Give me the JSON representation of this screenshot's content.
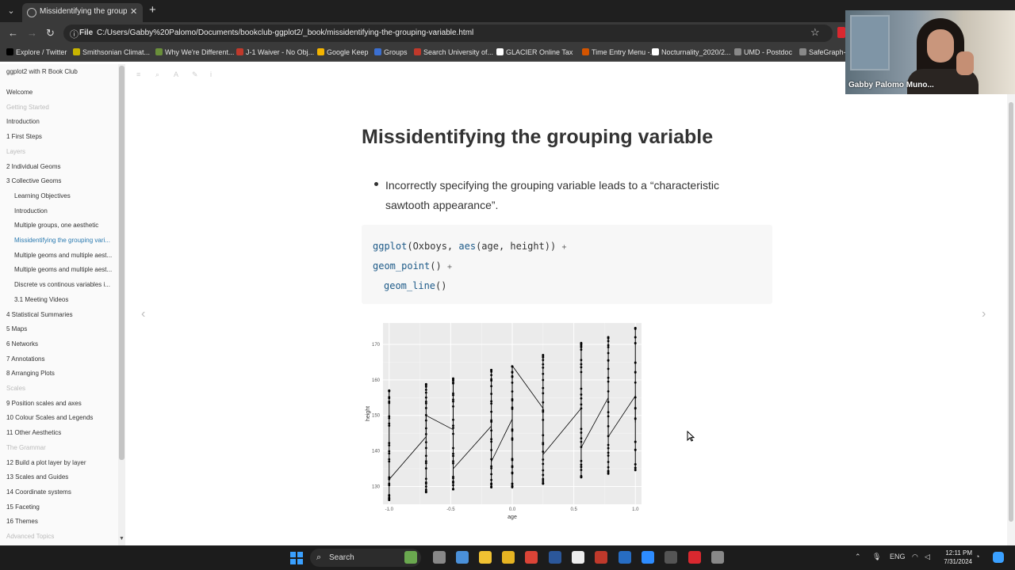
{
  "browser": {
    "tab_title": "Missidentifying the grouping va",
    "url_scheme": "File",
    "url": "C:/Users/Gabby%20Palomo/Documents/bookclub-ggplot2/_book/missidentifying-the-grouping-variable.html",
    "bookmarks": [
      {
        "label": "Explore / Twitter",
        "color": "#000000"
      },
      {
        "label": "Smithsonian Climat...",
        "color": "#c8b400"
      },
      {
        "label": "Why We're Different...",
        "color": "#6a8f3a"
      },
      {
        "label": "J-1 Waiver - No Obj...",
        "color": "#c0392b"
      },
      {
        "label": "Google Keep",
        "color": "#f4b400"
      },
      {
        "label": "Groups",
        "color": "#3b6fd1"
      },
      {
        "label": "Search University of...",
        "color": "#c0392b"
      },
      {
        "label": "GLACIER Online Tax",
        "color": "#ffffff"
      },
      {
        "label": "Time Entry Menu -...",
        "color": "#d35400"
      },
      {
        "label": "Nocturnality_2020/2...",
        "color": "#ffffff"
      },
      {
        "label": "UMD - Postdoc",
        "color": "#888888"
      },
      {
        "label": "SafeGraph-D",
        "color": "#888888"
      }
    ]
  },
  "sidebar": {
    "title": "ggplot2 with R Book Club",
    "items": [
      {
        "label": "Welcome",
        "kind": "item"
      },
      {
        "label": "Getting Started",
        "kind": "part"
      },
      {
        "label": "Introduction",
        "kind": "item"
      },
      {
        "label": "1 First Steps",
        "kind": "item"
      },
      {
        "label": "Layers",
        "kind": "part"
      },
      {
        "label": "2 Individual Geoms",
        "kind": "item"
      },
      {
        "label": "3 Collective Geoms",
        "kind": "item"
      },
      {
        "label": "Learning Objectives",
        "kind": "sub"
      },
      {
        "label": "Introduction",
        "kind": "sub"
      },
      {
        "label": "Multiple groups, one aesthetic",
        "kind": "sub"
      },
      {
        "label": "Missidentifying the grouping vari...",
        "kind": "active"
      },
      {
        "label": "Multiple geoms and multiple aest...",
        "kind": "sub"
      },
      {
        "label": "Multiple geoms and multiple aest...",
        "kind": "sub"
      },
      {
        "label": "Discrete vs continous variables i...",
        "kind": "sub"
      },
      {
        "label": "3.1 Meeting Videos",
        "kind": "sub"
      },
      {
        "label": "4 Statistical Summaries",
        "kind": "item"
      },
      {
        "label": "5 Maps",
        "kind": "item"
      },
      {
        "label": "6 Networks",
        "kind": "item"
      },
      {
        "label": "7 Annotations",
        "kind": "item"
      },
      {
        "label": "8 Arranging Plots",
        "kind": "item"
      },
      {
        "label": "Scales",
        "kind": "part"
      },
      {
        "label": "9 Position scales and axes",
        "kind": "item"
      },
      {
        "label": "10 Colour Scales and Legends",
        "kind": "item"
      },
      {
        "label": "11 Other Aesthetics",
        "kind": "item"
      },
      {
        "label": "The Grammar",
        "kind": "part"
      },
      {
        "label": "12 Build a plot layer by layer",
        "kind": "item"
      },
      {
        "label": "13 Scales and Guides",
        "kind": "item"
      },
      {
        "label": "14 Coordinate systems",
        "kind": "item"
      },
      {
        "label": "15 Faceting",
        "kind": "item"
      },
      {
        "label": "16 Themes",
        "kind": "item"
      },
      {
        "label": "Advanced Topics",
        "kind": "part"
      }
    ]
  },
  "main": {
    "title": "Missidentifying the grouping variable",
    "bullet": "Incorrectly specifying the grouping variable leads to a “characteristic sawtooth appearance”.",
    "code": {
      "line1_fn": "ggplot",
      "line1_rest": "(Oxboys, ",
      "line1_aes": "aes",
      "line1_args": "(age, height)) ",
      "line1_op": "+",
      "line2_fn": "geom_point",
      "line2_rest": "() ",
      "line2_op": "+",
      "line3_fn": "geom_line",
      "line3_rest": "()"
    }
  },
  "chart_data": {
    "type": "line",
    "xlabel": "age",
    "ylabel": "height",
    "xlim": [
      -1.05,
      1.05
    ],
    "ylim": [
      125,
      176
    ],
    "x_ticks": [
      "-1.0",
      "-0.5",
      "0.0",
      "0.5",
      "1.0"
    ],
    "x_tick_values": [
      -1.0,
      -0.5,
      0.0,
      0.5,
      1.0
    ],
    "y_ticks": [
      "130",
      "140",
      "150",
      "160",
      "170"
    ],
    "y_tick_values": [
      130,
      140,
      150,
      160,
      170
    ],
    "age_columns": [
      {
        "x": -1.0,
        "min": 126.2,
        "max": 157.0
      },
      {
        "x": -0.7,
        "min": 128.4,
        "max": 158.8
      },
      {
        "x": -0.48,
        "min": 129.2,
        "max": 160.4
      },
      {
        "x": -0.17,
        "min": 129.8,
        "max": 162.8
      },
      {
        "x": 0.0,
        "min": 129.8,
        "max": 163.8
      },
      {
        "x": 0.25,
        "min": 130.8,
        "max": 167.0
      },
      {
        "x": 0.56,
        "min": 132.6,
        "max": 170.4
      },
      {
        "x": 0.78,
        "min": 133.6,
        "max": 172.0
      },
      {
        "x": 1.0,
        "min": 134.6,
        "max": 174.6
      }
    ],
    "line": {
      "x": [
        -1.0,
        -0.7,
        -0.7,
        -0.48,
        -0.48,
        -0.17,
        -0.17,
        0.0,
        0.0,
        0.25,
        0.25,
        0.56,
        0.56,
        0.78,
        0.78,
        1.0,
        1.0
      ],
      "y": [
        132.0,
        144.0,
        150.0,
        146.0,
        135.0,
        147.0,
        137.0,
        149.0,
        164.0,
        152.0,
        139.0,
        152.0,
        141.0,
        155.0,
        144.0,
        155.5,
        148.0
      ]
    }
  },
  "webcam": {
    "name": "Gabby Palomo Muno..."
  },
  "taskbar": {
    "search_label": "Search",
    "lang": "ENG",
    "time": "12:11 PM",
    "date": "7/31/2024",
    "apps": [
      {
        "name": "widgets",
        "color": "#6aa84f"
      },
      {
        "name": "task-view",
        "color": "#888888"
      },
      {
        "name": "settings",
        "color": "#4a90d9"
      },
      {
        "name": "sticky-notes",
        "color": "#f1c232"
      },
      {
        "name": "file-explorer",
        "color": "#e6b422"
      },
      {
        "name": "chrome",
        "color": "#db4437"
      },
      {
        "name": "word",
        "color": "#2b579a"
      },
      {
        "name": "notion",
        "color": "#eeeeee"
      },
      {
        "name": "snipping-tool",
        "color": "#c0392b"
      },
      {
        "name": "r",
        "color": "#276dc3"
      },
      {
        "name": "zoom",
        "color": "#2d8cff"
      },
      {
        "name": "mendeley",
        "color": "#555555"
      },
      {
        "name": "acrobat",
        "color": "#d9282f"
      },
      {
        "name": "misc-app",
        "color": "#888888"
      }
    ]
  }
}
